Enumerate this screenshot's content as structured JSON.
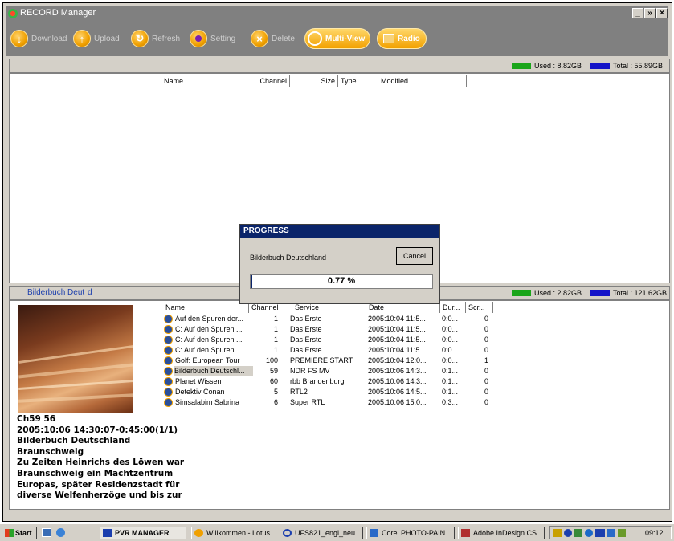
{
  "window": {
    "title": "RECORD Manager",
    "minimize": "_",
    "maximize": "»",
    "close": "×"
  },
  "toolbar": {
    "download": "Download",
    "upload": "Upload",
    "refresh": "Refresh",
    "setting": "Setting",
    "delete": "Delete",
    "multiview": "Multi-View",
    "radio": "Radio"
  },
  "top_storage": {
    "used": "Used : 8.82GB",
    "total": "Total : 55.89GB",
    "used_color": "#1aa51a",
    "total_color": "#1414c8"
  },
  "top_columns": [
    "Name",
    "Channel",
    "Size",
    "Type",
    "Modified"
  ],
  "bottom_storage": {
    "current": "Bilderbuch Deut",
    "current_suffix": "d",
    "used": "Used : 2.82GB",
    "total": "Total : 121.62GB"
  },
  "bottom_columns": [
    "Name",
    "Channel",
    "Service",
    "Date",
    "Dur...",
    "Scr..."
  ],
  "recordings": [
    {
      "name": "Auf den Spuren der...",
      "channel": "1",
      "service": "Das Erste",
      "date": "2005:10:04 11:5...",
      "dur": "0:0...",
      "scr": "0"
    },
    {
      "name": "C: Auf den Spuren ...",
      "channel": "1",
      "service": "Das Erste",
      "date": "2005:10:04 11:5...",
      "dur": "0:0...",
      "scr": "0"
    },
    {
      "name": "C: Auf den Spuren ...",
      "channel": "1",
      "service": "Das Erste",
      "date": "2005:10:04 11:5...",
      "dur": "0:0...",
      "scr": "0"
    },
    {
      "name": "C: Auf den Spuren ...",
      "channel": "1",
      "service": "Das Erste",
      "date": "2005:10:04 11:5...",
      "dur": "0:0...",
      "scr": "0"
    },
    {
      "name": "Golf: European Tour",
      "channel": "100",
      "service": "PREMIERE START",
      "date": "2005:10:04 12:0...",
      "dur": "0:0...",
      "scr": "1"
    },
    {
      "name": "Bilderbuch Deutschl...",
      "channel": "59",
      "service": "NDR FS MV",
      "date": "2005:10:06 14:3...",
      "dur": "0:1...",
      "scr": "0"
    },
    {
      "name": "Planet Wissen",
      "channel": "60",
      "service": "rbb Brandenburg",
      "date": "2005:10:06 14:3...",
      "dur": "0:1...",
      "scr": "0"
    },
    {
      "name": "Detektiv Conan",
      "channel": "5",
      "service": "RTL2",
      "date": "2005:10:06 14:5...",
      "dur": "0:1...",
      "scr": "0"
    },
    {
      "name": "Simsalabim Sabrina",
      "channel": "6",
      "service": "Super RTL",
      "date": "2005:10:06 15:0...",
      "dur": "0:3...",
      "scr": "0"
    }
  ],
  "info": {
    "line1": "Ch59 56",
    "line2": "2005:10:06 14:30:07-0:45:00(1/1)",
    "line3": "Bilderbuch Deutschland",
    "line4": "Braunschweig",
    "line5": "Zu Zeiten Heinrichs des Löwen war",
    "line6": "Braunschweig ein Machtzentrum",
    "line7": "Europas, später Residenzstadt für",
    "line8": "diverse Welfenherzöge und bis zur"
  },
  "progress": {
    "title": "PROGRESS",
    "item": "Bilderbuch Deutschland",
    "cancel": "Cancel",
    "percent_label": "0.77 %",
    "percent": 0.77
  },
  "taskbar": {
    "start": "Start",
    "items": [
      "PVR MANAGER",
      "Willkommen - Lotus ...",
      "UFS821_engl_neu",
      "Corel PHOTO-PAIN...",
      "Adobe InDesign CS ..."
    ],
    "clock": "09:12"
  }
}
